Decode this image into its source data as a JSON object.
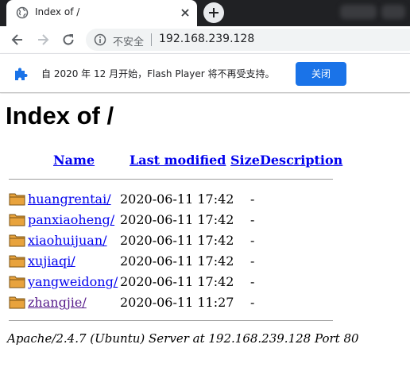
{
  "browser": {
    "tab_title": "Index of /",
    "insecure_label": "不安全",
    "url": "192.168.239.128"
  },
  "infobar": {
    "message": "自 2020 年 12 月开始，Flash Player 将不再受支持。",
    "close_label": "关闭"
  },
  "page": {
    "heading": "Index of /",
    "columns": {
      "name": "Name",
      "modified": "Last modified",
      "size": "Size",
      "description": "Description"
    },
    "rows": [
      {
        "name": "huangrentai/",
        "modified": "2020-06-11 17:42",
        "size": "-"
      },
      {
        "name": "panxiaoheng/",
        "modified": "2020-06-11 17:42",
        "size": "-"
      },
      {
        "name": "xiaohuijuan/",
        "modified": "2020-06-11 17:42",
        "size": "-"
      },
      {
        "name": "xujiaqi/",
        "modified": "2020-06-11 17:42",
        "size": "-"
      },
      {
        "name": "yangweidong/",
        "modified": "2020-06-11 17:42",
        "size": "-"
      },
      {
        "name": "zhangjie/",
        "modified": "2020-06-11 11:27",
        "size": "-"
      }
    ],
    "server_signature": "Apache/2.4.7 (Ubuntu) Server at 192.168.239.128 Port 80"
  },
  "icons": {
    "tab_favicon": "globe-icon",
    "tab_close": "close-icon",
    "new_tab": "plus-icon",
    "back": "back-arrow-icon",
    "forward": "forward-arrow-icon",
    "reload": "reload-icon",
    "site_info": "info-icon",
    "infobar": "puzzle-icon",
    "folder": "folder-icon"
  },
  "colors": {
    "link": "#0000ee",
    "visited_link": "#551a8b",
    "button_blue": "#1a73e8",
    "tabstrip": "#202124"
  }
}
